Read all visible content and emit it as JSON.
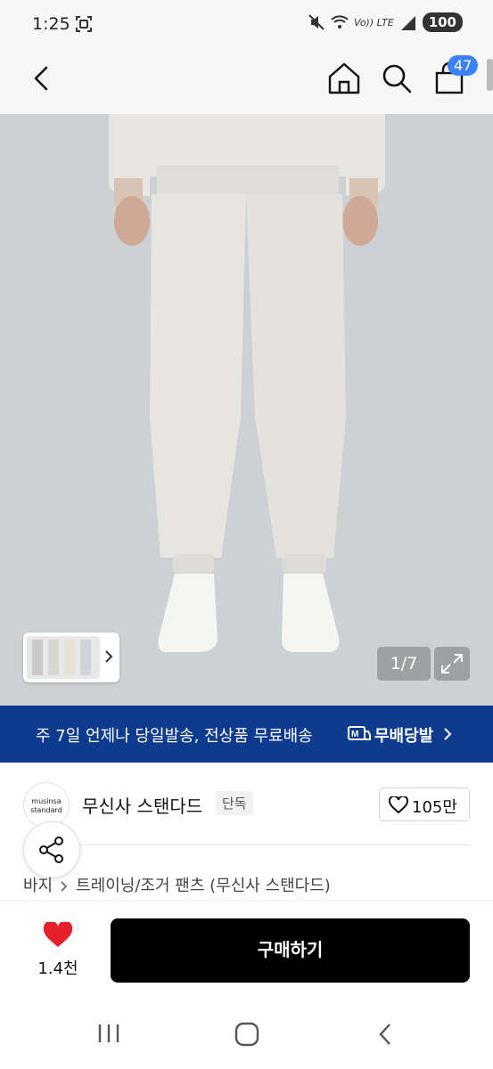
{
  "status_bar": {
    "time": "1:25",
    "volte": "Vo)) LTE",
    "battery": "100",
    "icons": [
      "screenshot-icon",
      "mute-icon",
      "wifi-icon",
      "volte-icon",
      "signal-icon"
    ]
  },
  "header": {
    "icons": [
      "back-arrow-icon",
      "home-icon",
      "search-icon",
      "shopping-bag-icon"
    ],
    "cart_count": "47"
  },
  "gallery": {
    "counter": "1/7",
    "icons": [
      "chevron-right-icon",
      "expand-icon"
    ]
  },
  "shipping_banner": {
    "text": "주 7일 언제나 당일발송, 전상품 무료배송",
    "brand": "무배당발",
    "icons": [
      "truck-m-logo-icon",
      "chevron-right-icon"
    ]
  },
  "brand": {
    "logo_line1": "musinsa",
    "logo_line2": "standard",
    "name": "무신사 스탠다드",
    "badge": "단독",
    "like_count": "105만"
  },
  "breadcrumb": {
    "category": "바지",
    "subcategory": "트레이닝/조거 팬츠 (무신사 스탠다드)"
  },
  "bottom_bar": {
    "wish_count": "1.4천",
    "buy_label": "구매하기"
  },
  "colors": {
    "banner": "#0f3b8f",
    "badge": "#3b82f6",
    "heart": "#e5202b",
    "buy_button": "#000000"
  }
}
